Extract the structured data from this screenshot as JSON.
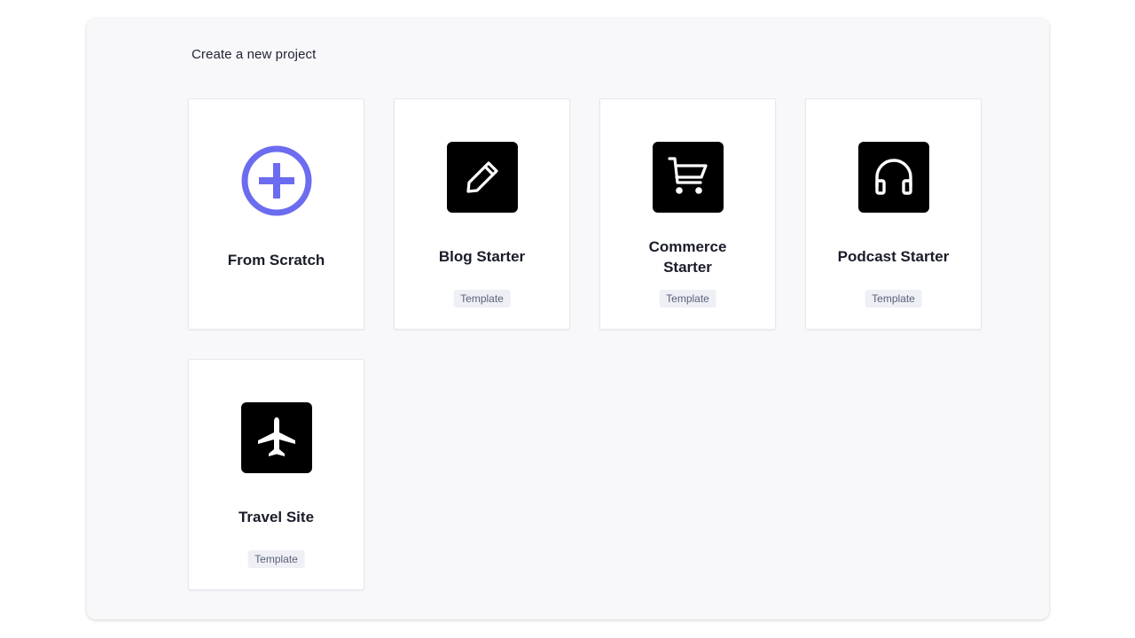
{
  "header": {
    "title": "Create a new project"
  },
  "cards": [
    {
      "title": "From Scratch",
      "tag": "",
      "icon": "plus-circle-icon",
      "accent": "#6c6cf0"
    },
    {
      "title": "Blog Starter",
      "tag": "Template",
      "icon": "pencil-icon"
    },
    {
      "title": "Commerce Starter",
      "tag": "Template",
      "icon": "shopping-cart-icon"
    },
    {
      "title": "Podcast Starter",
      "tag": "Template",
      "icon": "headphones-icon"
    },
    {
      "title": "Travel Site",
      "tag": "Template",
      "icon": "airplane-icon"
    }
  ],
  "colors": {
    "accent": "#6c6cf0",
    "panel_bg": "#f8f8fb",
    "tag_bg": "#eef0f6"
  }
}
